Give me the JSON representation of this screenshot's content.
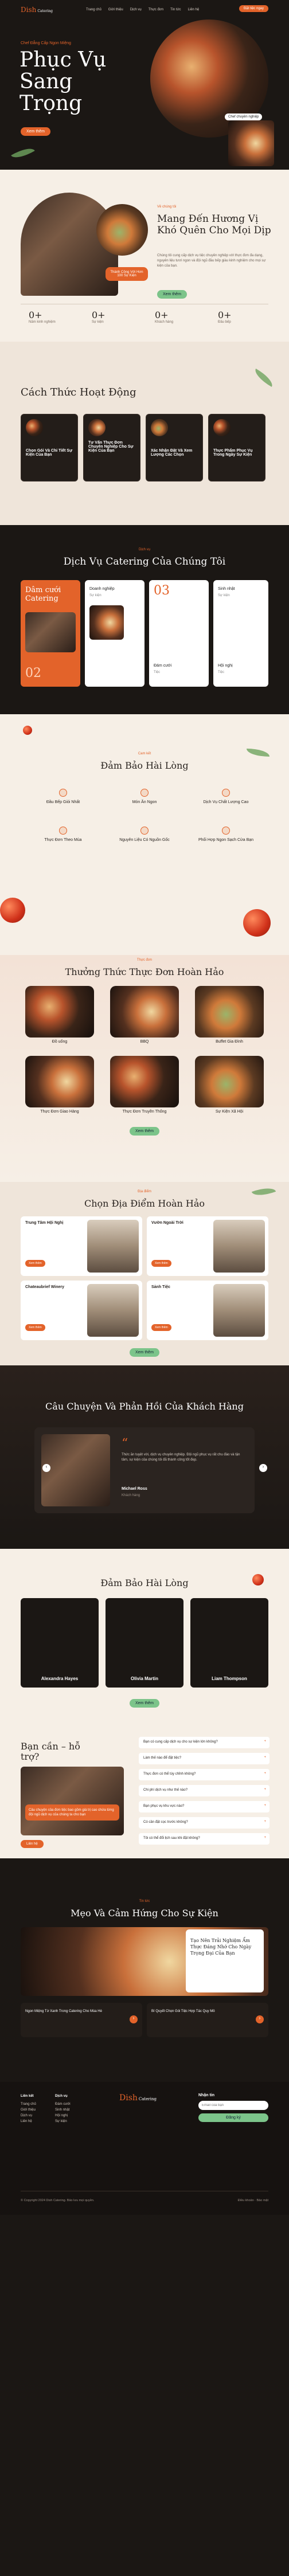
{
  "nav": {
    "logo_main": "Dish",
    "logo_sub": "Catering",
    "items": [
      "Trang chủ",
      "Giới thiệu",
      "Dịch vụ",
      "Thực đơn",
      "Tin tức",
      "Liên hệ"
    ],
    "cta": "Đặt tiệc ngay"
  },
  "hero": {
    "eyebrow": "Chef Đẳng Cấp Ngon Miệng",
    "title_1": "Phục Vụ",
    "title_2": "Sang",
    "title_3": "Trọng",
    "subtitle": "Chef chuyên nghiệp",
    "cta": "Xem thêm"
  },
  "about": {
    "eyebrow": "Về chúng tôi",
    "title": "Mang Đến Hương Vị Khó Quên Cho Mọi Dịp",
    "text": "Chúng tôi cung cấp dịch vụ tiệc chuyên nghiệp với thực đơn đa dạng, nguyên liệu tươi ngon và đội ngũ đầu bếp giàu kinh nghiệm cho mọi sự kiện của bạn.",
    "badge": "Thành Công Với Hơn 100 Sự Kiện",
    "cta": "Xem thêm"
  },
  "stats": [
    {
      "value": "0+",
      "label": "Năm kinh nghiệm"
    },
    {
      "value": "0+",
      "label": "Sự kiện"
    },
    {
      "value": "0+",
      "label": "Khách hàng"
    },
    {
      "value": "0+",
      "label": "Đầu bếp"
    }
  ],
  "process": {
    "title": "Cách Thức Hoạt Động",
    "steps": [
      "Chọn Gói Và Chi Tiết Sự Kiện Của Bạn",
      "Tư Vấn Thực Đơn Chuyên Nghiệp Cho Sự Kiện Của Bạn",
      "Xác Nhận Đặt Và Xem Lượng Các Chọn",
      "Thực Phẩm Phục Vụ Trong Ngày Sự Kiện"
    ]
  },
  "services": {
    "eyebrow": "Dịch vụ",
    "title": "Dịch Vụ Catering Của Chúng Tôi",
    "feature": "Dâm cưới Catering",
    "tag": "Xem thêm",
    "items": [
      {
        "name": "Doanh nghiệp",
        "sub": "Sự kiện"
      },
      {
        "name": "Sinh nhật",
        "sub": "Sự kiện"
      },
      {
        "name": "Đám cưới",
        "sub": "Tiệc"
      },
      {
        "name": "Hội nghị",
        "sub": "Tiệc"
      }
    ],
    "nums": [
      "02",
      "03",
      "02",
      "03"
    ]
  },
  "assurance": {
    "eyebrow": "Cam kết",
    "title": "Đảm Bảo Hài Lòng",
    "items": [
      "Đầu Bếp Giỏi Nhất",
      "Món Ăn Ngon",
      "Dịch Vụ Chất Lượng Cao",
      "Thực Đơn Theo Mùa",
      "Nguyên Liệu Có Nguồn Gốc",
      "Phối Hợp Ngon Sạch Cửa Bạn"
    ]
  },
  "menu": {
    "eyebrow": "Thực đơn",
    "title": "Thưởng Thức Thực Đơn Hoàn Hảo",
    "dishes": [
      "Đồ uống",
      "BBQ",
      "Buffet Gia Đình",
      "Thực Đơn Giao Hàng",
      "Thực Đơn Truyền Thống",
      "Sự Kiện Xã Hội"
    ],
    "cta": "Xem thêm"
  },
  "venues": {
    "eyebrow": "Địa điểm",
    "title": "Chọn Địa Điểm Hoàn Hảo",
    "list": [
      {
        "name": "Trung Tâm Hội Nghị",
        "cta": "Xem thêm"
      },
      {
        "name": "Vườn Ngoài Trời",
        "cta": "Xem thêm"
      },
      {
        "name": "Chateaubrief Winery",
        "cta": "Xem thêm"
      },
      {
        "name": "Sảnh Tiệc",
        "cta": "Xem thêm"
      }
    ],
    "cta": "Xem thêm"
  },
  "testimonial": {
    "title": "Câu Chuyện Và Phản Hồi Của Khách Hàng",
    "quote": "Thức ăn tuyệt vời, dịch vụ chuyên nghiệp. Đội ngũ phục vụ rất chu đáo và tận tâm, sự kiện của chúng tôi đã thành công tốt đẹp.",
    "name": "Michael Ross",
    "role": "Khách hàng"
  },
  "team": {
    "title": "Đảm Bảo Hài Lòng",
    "members": [
      "Alexandra Hayes",
      "Olivia Martin",
      "Liam Thompson"
    ],
    "cta": "Xem thêm"
  },
  "faq": {
    "title_1": "Bạn cần – hỗ",
    "title_2": "trợ?",
    "card": "Câu chuyện của đơn tiệc bao gồm giá trị cao chứa từng đội ngũ dịch vụ của chúng ta cho bạn",
    "cta": "Liên hệ",
    "questions": [
      "Bạn có cung cấp dịch vụ cho sự kiện lớn không?",
      "Làm thế nào để đặt tiệc?",
      "Thực đơn có thể tùy chỉnh không?",
      "Chi phí dịch vụ như thế nào?",
      "Bạn phục vụ khu vực nào?",
      "Có cần đặt cọc trước không?",
      "Tôi có thể đổi lịch sau khi đặt không?"
    ]
  },
  "blog": {
    "eyebrow": "Tin tức",
    "title": "Mẹo Và Cảm Hứng Cho Sự Kiện",
    "feature": "Tạo Nên Trải Nghiệm Ẩm Thực Đáng Nhớ Cho Ngày Trọng Đại Của Bạn",
    "posts": [
      "Ngon Miệng Từ Xanh Trong Catering Cho Mùa Hè",
      "Bí Quyết Chọn Gói Tiệc Hợp Tác Quy Mô"
    ]
  },
  "footer": {
    "col1_title": "Liên kết",
    "col1": [
      "Trang chủ",
      "Giới thiệu",
      "Dịch vụ",
      "Liên hệ"
    ],
    "col2_title": "Dịch vụ",
    "col2": [
      "Đám cưới",
      "Sinh nhật",
      "Hội nghị",
      "Sự kiện"
    ],
    "newsletter_title": "Nhận tin",
    "newsletter_placeholder": "Email của bạn",
    "subscribe": "Đăng ký",
    "copyright": "© Copyright 2024 Dish Catering. Bảo lưu mọi quyền.",
    "links": "Điều khoản · Bảo mật"
  }
}
